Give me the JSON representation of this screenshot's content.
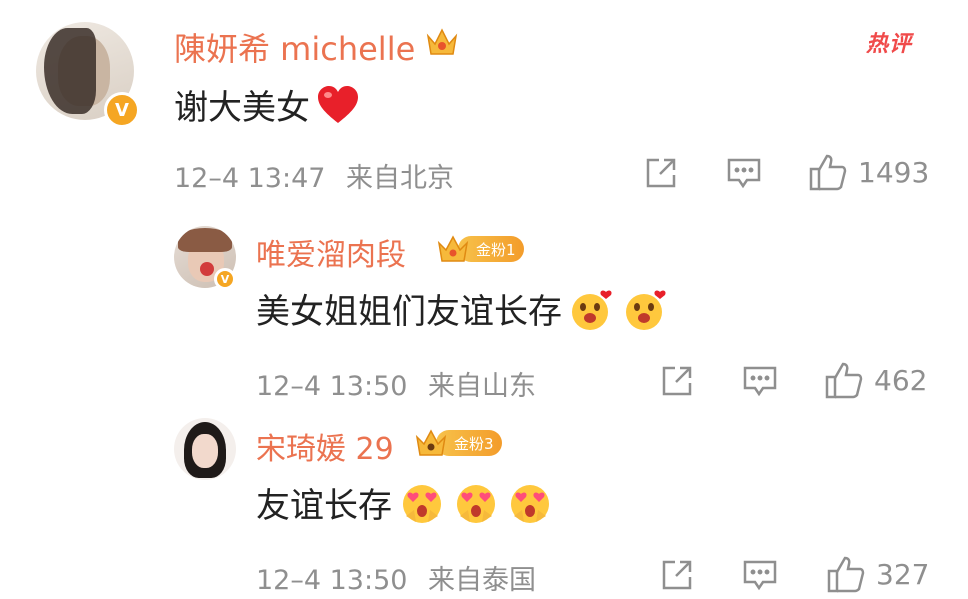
{
  "hot_label": "热评",
  "comments": [
    {
      "username": "陳妍希 michelle",
      "text": "谢大美女",
      "time": "12–4 13:47",
      "location": "来自北京",
      "likes": "1493",
      "verified_badge": "V",
      "emoji": [
        "red-heart"
      ]
    },
    {
      "username": "唯爱溜肉段",
      "fan_badge": "金粉1",
      "text": "美女姐姐们友谊长存",
      "time": "12–4 13:50",
      "location": "来自山东",
      "likes": "462",
      "emoji": [
        "heart-face",
        "heart-face"
      ]
    },
    {
      "username": "宋琦媛 29",
      "fan_badge": "金粉3",
      "text": "友谊长存",
      "time": "12–4 13:50",
      "location": "来自泰国",
      "likes": "327",
      "emoji": [
        "heart-eyes-face",
        "heart-eyes-face",
        "heart-eyes-face"
      ]
    }
  ],
  "colors": {
    "username": "#eb7350",
    "meta": "#8f8f8f",
    "hot": "#f04a4a",
    "badge": "#f5a623"
  }
}
